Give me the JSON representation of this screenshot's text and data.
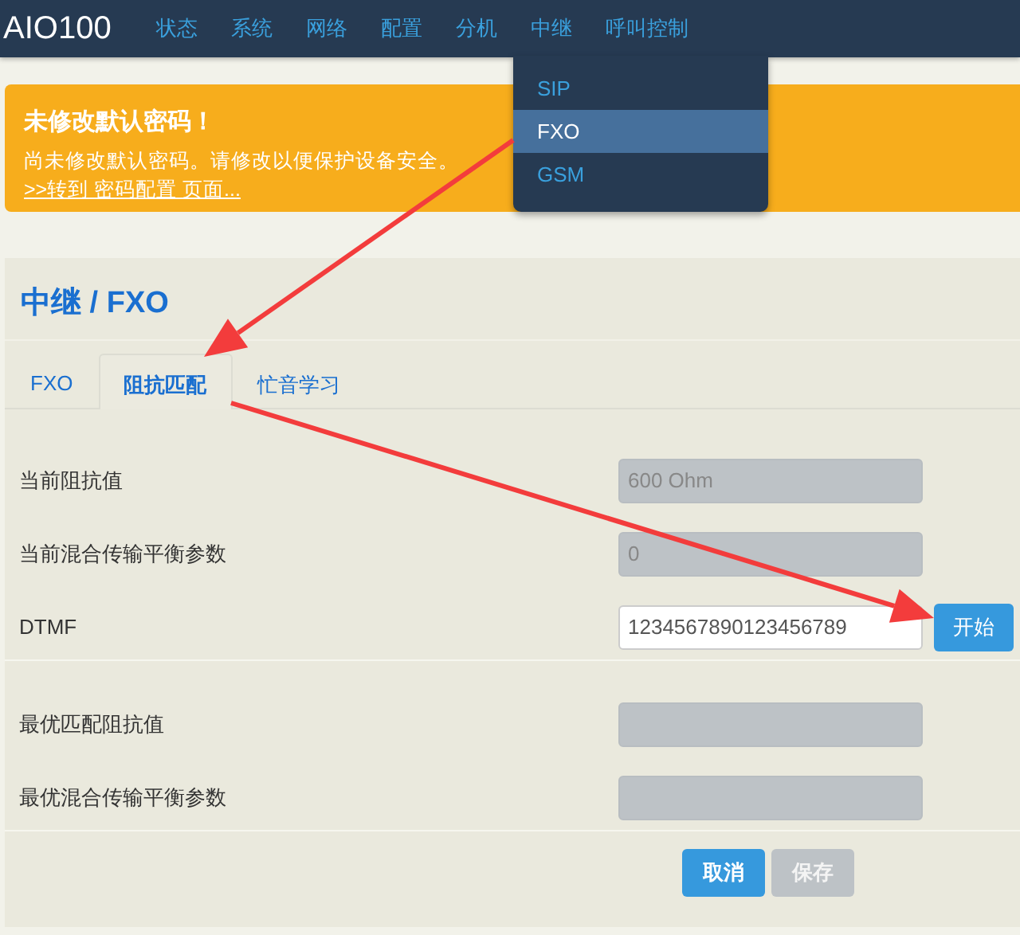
{
  "navbar": {
    "brand": "AIO100",
    "items": [
      {
        "label": "状态"
      },
      {
        "label": "系统"
      },
      {
        "label": "网络"
      },
      {
        "label": "配置"
      },
      {
        "label": "分机"
      },
      {
        "label": "中继",
        "expanded": true
      },
      {
        "label": "呼叫控制"
      }
    ]
  },
  "dropdown": {
    "items": [
      {
        "label": "SIP",
        "selected": false
      },
      {
        "label": "FXO",
        "selected": true
      },
      {
        "label": "GSM",
        "selected": false
      }
    ]
  },
  "alert": {
    "title": "未修改默认密码！",
    "message": "尚未修改默认密码。请修改以便保护设备安全。",
    "link": ">>转到 密码配置 页面..."
  },
  "page_title": "中继 / FXO",
  "tabs": [
    {
      "label": "FXO",
      "selected": false
    },
    {
      "label": "阻抗匹配",
      "selected": true
    },
    {
      "label": "忙音学习",
      "selected": false
    }
  ],
  "sections": [
    {
      "fields": [
        {
          "label": "当前阻抗值",
          "value": "600 Ohm",
          "disabled": true
        },
        {
          "label": "当前混合传输平衡参数",
          "value": "0",
          "disabled": true
        },
        {
          "label": "DTMF",
          "value": "1234567890123456789",
          "disabled": false,
          "button": "开始"
        }
      ]
    },
    {
      "fields": [
        {
          "label": "最优匹配阻抗值",
          "disabled": true
        },
        {
          "label": "最优混合传输平衡参数",
          "disabled": true
        }
      ]
    }
  ],
  "buttons": [
    {
      "label": "取消",
      "disabled": false
    },
    {
      "label": "保存",
      "disabled": true
    }
  ]
}
